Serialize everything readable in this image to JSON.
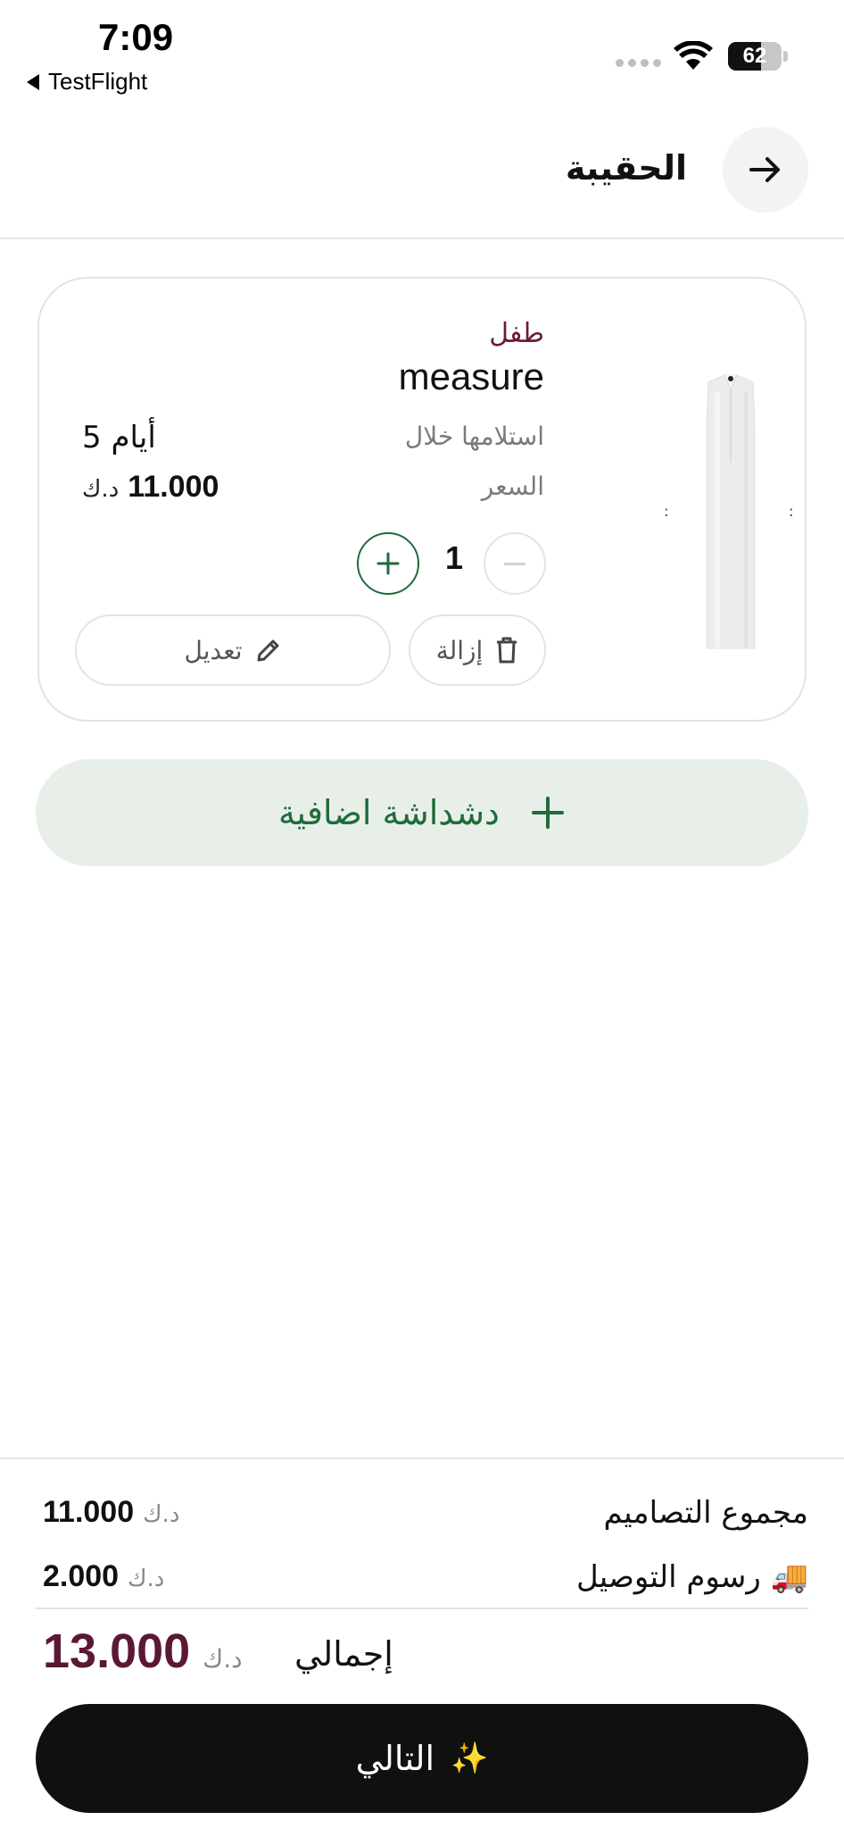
{
  "status_bar": {
    "time": "7:09",
    "back_app": "TestFlight",
    "battery": "62",
    "battery_level": 0.62
  },
  "header": {
    "title": "الحقيبة",
    "back_icon": "arrow-right-icon"
  },
  "cart_item": {
    "category": "طفل",
    "name": "measure",
    "delivery_label": "استلامها خلال",
    "delivery_value": "5 أيام",
    "price_label": "السعر",
    "price_value": "11.000",
    "currency": "د.ك",
    "quantity": "1",
    "remove_label": "إزالة",
    "edit_label": "تعديل"
  },
  "add_extra": {
    "label": "دشداشة اضافية"
  },
  "summary": {
    "designs_total_label": "مجموع التصاميم",
    "designs_total_value": "11.000",
    "delivery_fee_label": "رسوم التوصيل 🚚",
    "delivery_fee_value": "2.000",
    "total_label": "إجمالي",
    "total_value": "13.000",
    "currency": "د.ك"
  },
  "next_button": {
    "label": "التالي",
    "sparkle": "✨"
  },
  "colors": {
    "accent_green": "#1f6b3c",
    "accent_maroon": "#5b1834",
    "button_dark": "#0f1110",
    "add_bg": "#e8efe9"
  }
}
